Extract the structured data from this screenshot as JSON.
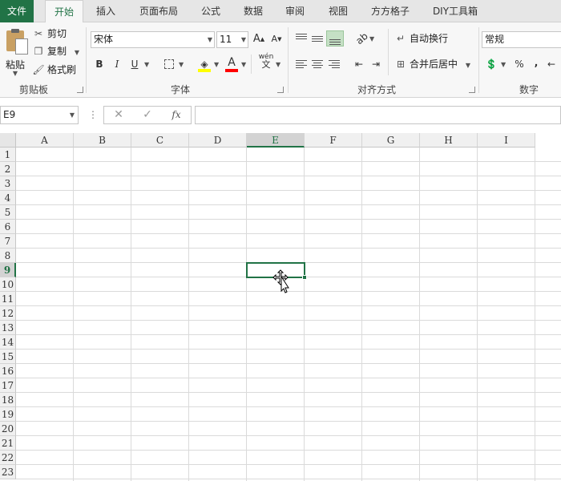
{
  "tabs": [
    "文件",
    "开始",
    "插入",
    "页面布局",
    "公式",
    "数据",
    "审阅",
    "视图",
    "方方格子",
    "DIY工具箱"
  ],
  "active_tab": "开始",
  "clipboard": {
    "paste": "粘贴",
    "cut": "剪切",
    "copy": "复制",
    "format_painter": "格式刷",
    "group_label": "剪贴板"
  },
  "font": {
    "name": "宋体",
    "size": "11",
    "bold": "B",
    "italic": "I",
    "underline": "U",
    "grow": "A",
    "shrink": "A",
    "phonetic": "wén",
    "phonetic_char": "文",
    "font_color_glyph": "A",
    "group_label": "字体",
    "fill_color": "#ffff00",
    "font_color": "#ff0000"
  },
  "alignment": {
    "wrap_text": "自动换行",
    "merge_center": "合并后居中",
    "group_label": "对齐方式"
  },
  "number": {
    "format": "常规",
    "percent": "%",
    "comma": ",",
    "group_label": "数字"
  },
  "formula_bar": {
    "name_box": "E9",
    "dots": "⋮",
    "cancel": "✕",
    "enter": "✓",
    "fx": "fx",
    "content": ""
  },
  "sheet": {
    "columns": [
      "A",
      "B",
      "C",
      "D",
      "E",
      "F",
      "G",
      "H",
      "I"
    ],
    "rows": [
      "1",
      "2",
      "3",
      "4",
      "5",
      "6",
      "7",
      "8",
      "9",
      "10",
      "11",
      "12",
      "13",
      "14",
      "15",
      "16",
      "17",
      "18",
      "19",
      "20",
      "21",
      "22",
      "23"
    ],
    "selected_column": "E",
    "selected_row": "9"
  },
  "colors": {
    "accent": "#217346",
    "file_tab": "#217346"
  }
}
